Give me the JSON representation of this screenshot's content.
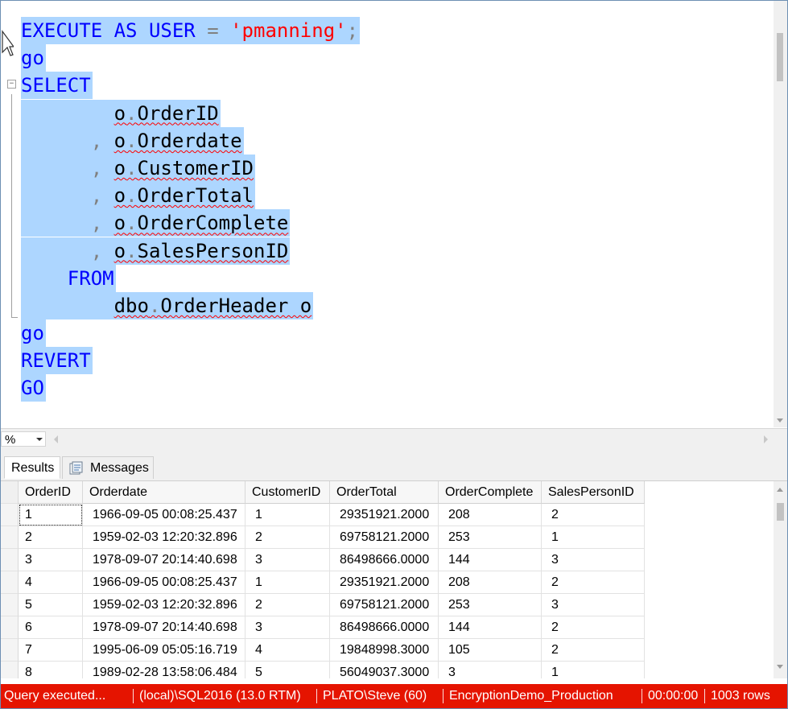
{
  "editor": {
    "lines": [
      {
        "id": "l1",
        "parts": [
          {
            "t": "EXECUTE AS USER",
            "c": "kw"
          },
          {
            "t": " = ",
            "c": "gray"
          },
          {
            "t": "'pmanning'",
            "c": "str"
          },
          {
            "t": ";",
            "c": "gray"
          }
        ]
      },
      {
        "id": "l2",
        "parts": [
          {
            "t": "go",
            "c": "kw"
          }
        ]
      },
      {
        "id": "l3",
        "parts": [
          {
            "t": "SELECT",
            "c": "kw"
          }
        ]
      },
      {
        "id": "l4",
        "parts": [
          {
            "t": "        "
          },
          {
            "t": "o",
            "c": "ident sq"
          },
          {
            "t": ".",
            "c": "gray sq"
          },
          {
            "t": "OrderID",
            "c": "ident sq"
          }
        ]
      },
      {
        "id": "l5",
        "parts": [
          {
            "t": "      "
          },
          {
            "t": ", ",
            "c": "gray"
          },
          {
            "t": "o",
            "c": "ident sq"
          },
          {
            "t": ".",
            "c": "gray sq"
          },
          {
            "t": "Orderdate",
            "c": "ident sq"
          }
        ]
      },
      {
        "id": "l6",
        "parts": [
          {
            "t": "      "
          },
          {
            "t": ", ",
            "c": "gray"
          },
          {
            "t": "o",
            "c": "ident sq"
          },
          {
            "t": ".",
            "c": "gray sq"
          },
          {
            "t": "CustomerID",
            "c": "ident sq"
          }
        ]
      },
      {
        "id": "l7",
        "parts": [
          {
            "t": "      "
          },
          {
            "t": ", ",
            "c": "gray"
          },
          {
            "t": "o",
            "c": "ident sq"
          },
          {
            "t": ".",
            "c": "gray sq"
          },
          {
            "t": "OrderTotal",
            "c": "ident sq"
          }
        ]
      },
      {
        "id": "l8",
        "parts": [
          {
            "t": "      "
          },
          {
            "t": ", ",
            "c": "gray"
          },
          {
            "t": "o",
            "c": "ident sq"
          },
          {
            "t": ".",
            "c": "gray sq"
          },
          {
            "t": "OrderComplete",
            "c": "ident sq"
          }
        ]
      },
      {
        "id": "l9",
        "parts": [
          {
            "t": "      "
          },
          {
            "t": ", ",
            "c": "gray"
          },
          {
            "t": "o",
            "c": "ident sq"
          },
          {
            "t": ".",
            "c": "gray sq"
          },
          {
            "t": "SalesPersonID",
            "c": "ident sq"
          }
        ]
      },
      {
        "id": "l10",
        "parts": [
          {
            "t": "    "
          },
          {
            "t": "FROM",
            "c": "kw"
          }
        ]
      },
      {
        "id": "l11",
        "parts": [
          {
            "t": "        "
          },
          {
            "t": "dbo",
            "c": "ident sq"
          },
          {
            "t": ".",
            "c": "gray sq"
          },
          {
            "t": "OrderHeader o",
            "c": "ident sq"
          }
        ]
      },
      {
        "id": "l12",
        "parts": [
          {
            "t": "go",
            "c": "kw"
          }
        ]
      },
      {
        "id": "l13",
        "parts": [
          {
            "t": "REVERT",
            "c": "kw"
          }
        ]
      },
      {
        "id": "l14",
        "parts": [
          {
            "t": "GO",
            "c": "kw"
          }
        ]
      }
    ]
  },
  "zoom": {
    "value": "%"
  },
  "tabs": {
    "results": "Results",
    "messages": "Messages"
  },
  "grid": {
    "columns": [
      "OrderID",
      "Orderdate",
      "CustomerID",
      "OrderTotal",
      "OrderComplete",
      "SalesPersonID"
    ],
    "rows": [
      [
        "1",
        "1966-09-05 00:08:25.437",
        "1",
        "29351921.2000",
        "208",
        "2"
      ],
      [
        "2",
        "1959-02-03 12:20:32.896",
        "2",
        "69758121.2000",
        "253",
        "1"
      ],
      [
        "3",
        "1978-09-07 20:14:40.698",
        "3",
        "86498666.0000",
        "144",
        "3"
      ],
      [
        "4",
        "1966-09-05 00:08:25.437",
        "1",
        "29351921.2000",
        "208",
        "2"
      ],
      [
        "5",
        "1959-02-03 12:20:32.896",
        "2",
        "69758121.2000",
        "253",
        "3"
      ],
      [
        "6",
        "1978-09-07 20:14:40.698",
        "3",
        "86498666.0000",
        "144",
        "2"
      ],
      [
        "7",
        "1995-06-09 05:05:16.719",
        "4",
        "19848998.3000",
        "105",
        "2"
      ],
      [
        "8",
        "1989-02-28 13:58:06.484",
        "5",
        "56049037.3000",
        "3",
        "1"
      ]
    ]
  },
  "status": {
    "query": "Query  executed...",
    "server": "(local)\\SQL2016 (13.0 RTM)",
    "user": "PLATO\\Steve (60)",
    "database": "EncryptionDemo_Production",
    "elapsed": "00:00:00",
    "rows": "1003 rows",
    "bg_color": "#e51400"
  }
}
